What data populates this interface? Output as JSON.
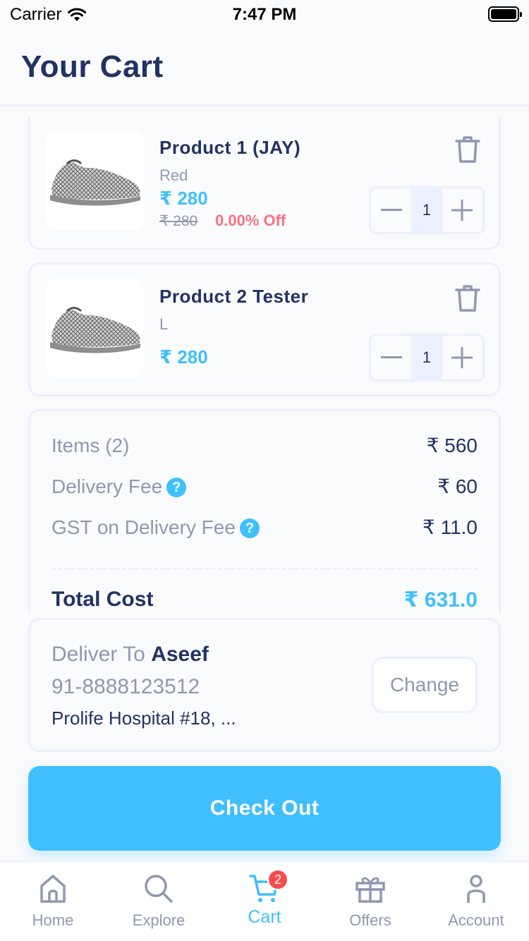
{
  "status_bar": {
    "carrier": "Carrier",
    "time": "7:47 PM"
  },
  "header": {
    "title": "Your Cart"
  },
  "cart_items": [
    {
      "name": "Product 1 (JAY)",
      "variant": "Red",
      "price": "₹ 280",
      "old_price": "₹ 280",
      "discount": "0.00% Off",
      "quantity": "1"
    },
    {
      "name": "Product 2 Tester",
      "variant": "L",
      "price": "₹ 280",
      "quantity": "1"
    }
  ],
  "summary": {
    "items_label": "Items (2)",
    "items_value": "₹ 560",
    "delivery_label": "Delivery Fee",
    "delivery_value": "₹ 60",
    "gst_label": "GST on Delivery Fee",
    "gst_value": "₹ 11.0",
    "help_glyph": "?",
    "total_label": "Total Cost",
    "total_value": "₹ 631.0"
  },
  "delivery": {
    "prefix": "Deliver To",
    "name": "Aseef",
    "phone": "91-8888123512",
    "address": "Prolife Hospital #18, ...",
    "change_label": "Change"
  },
  "checkout": {
    "label": "Check Out"
  },
  "tabs": [
    {
      "label": "Home",
      "icon": "home-icon"
    },
    {
      "label": "Explore",
      "icon": "search-icon"
    },
    {
      "label": "Cart",
      "icon": "cart-icon",
      "badge": "2",
      "active": true
    },
    {
      "label": "Offers",
      "icon": "gift-icon"
    },
    {
      "label": "Account",
      "icon": "user-icon"
    }
  ],
  "colors": {
    "primary": "#40bfff",
    "dark": "#223263",
    "grey": "#9098b1",
    "border": "#ebf0ff",
    "discount": "#fb7181",
    "badge": "#fb4a4a"
  }
}
